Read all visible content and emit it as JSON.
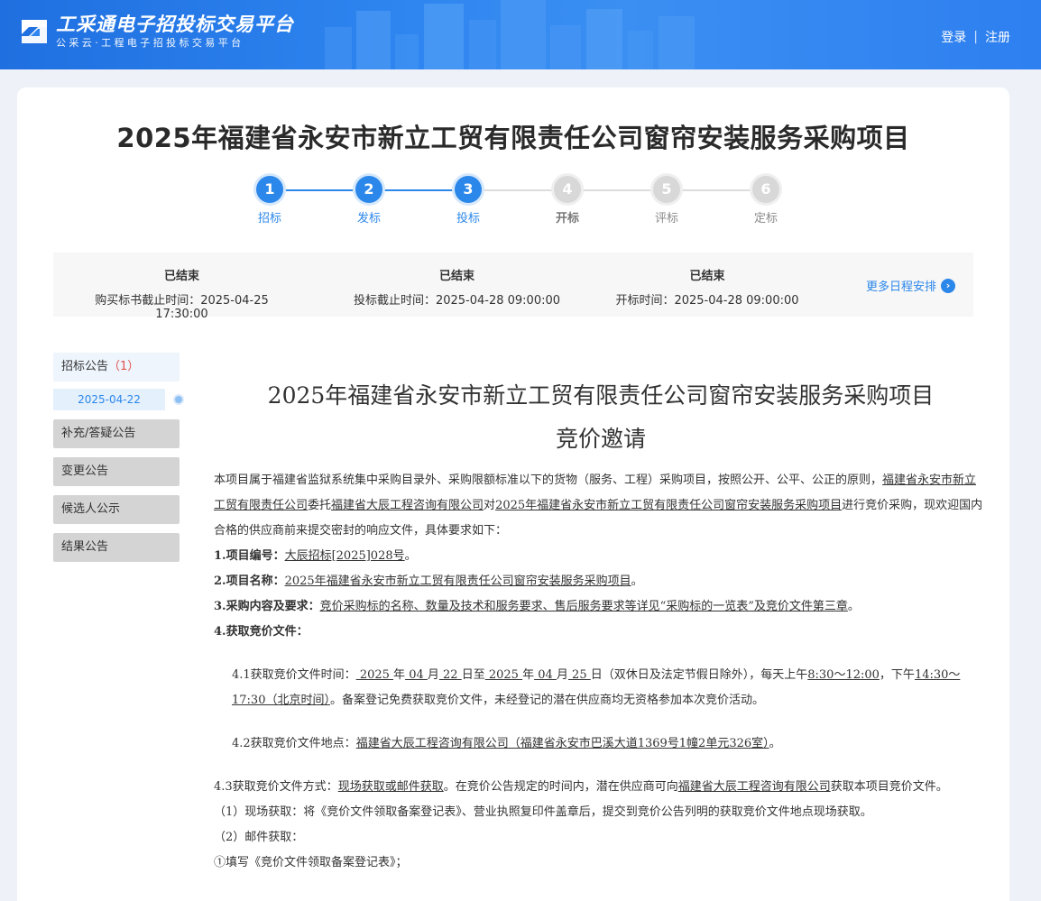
{
  "header": {
    "logo_title": "工采通电子招投标交易平台",
    "logo_subtitle": "公采云·工程电子招投标交易平台",
    "login": "登录",
    "divider": "|",
    "register": "注册"
  },
  "project": {
    "title": "2025年福建省永安市新立工贸有限责任公司窗帘安装服务采购项目"
  },
  "steps": [
    {
      "num": "1",
      "label": "招标",
      "state": "done"
    },
    {
      "num": "2",
      "label": "发标",
      "state": "done"
    },
    {
      "num": "3",
      "label": "投标",
      "state": "done"
    },
    {
      "num": "4",
      "label": "开标",
      "state": "todo"
    },
    {
      "num": "5",
      "label": "评标",
      "state": "todo"
    },
    {
      "num": "6",
      "label": "定标",
      "state": "todo"
    }
  ],
  "schedule": {
    "items": [
      {
        "status": "已结束",
        "text": "购买标书截止时间：2025-04-25 17:30:00"
      },
      {
        "status": "已结束",
        "text": "投标截止时间：2025-04-28 09:00:00"
      },
      {
        "status": "已结束",
        "text": "开标时间：2025-04-28 09:00:00"
      }
    ],
    "more_label": "更多日程安排"
  },
  "sidebar": {
    "active_label": "招标公告",
    "active_count": "（1）",
    "active_date": "2025-04-22",
    "items": [
      "补充/答疑公告",
      "变更公告",
      "候选人公示",
      "结果公告"
    ]
  },
  "article": {
    "title_line1": "2025年福建省永安市新立工贸有限责任公司窗帘安装服务采购项目",
    "title_line2": "竞价邀请",
    "intro_a": "本项目属于福建省监狱系统集中采购目录外、采购限额标准以下的货物（服务、工程）采购项目，按照公开、公平、公正的原则，",
    "intro_u1": "福建省永安市新立工贸有限责任公司",
    "intro_b": "委托",
    "intro_u2": "福建省大辰工程咨询有限公司",
    "intro_c": "对",
    "intro_u3": "2025年福建省永安市新立工贸有限责任公司窗帘安装服务采购项目",
    "intro_d": "进行竞价采购，现欢迎国内合格的供应商前来提交密封的响应文件，具体要求如下：",
    "item1_label": "1.项目编号：",
    "item1_value": "大辰招标[2025]028号",
    "item1_end": "。",
    "item2_label": "2.项目名称：",
    "item2_value": "2025年福建省永安市新立工贸有限责任公司窗帘安装服务采购项目",
    "item2_end": "。",
    "item3_label": "3.采购内容及要求：",
    "item3_value": "竞价采购标的名称、数量及技术和服务要求、售后服务要求等详见“采购标的一览表”及竞价文件第三章",
    "item3_end": "。",
    "item4_label": "4.获取竞价文件：",
    "s41_a": "4.1获取竞价文件时间：",
    "s41_u1": " 2025 ",
    "s41_t1": "年",
    "s41_u2": " 04 ",
    "s41_t2": "月",
    "s41_u3": " 22 ",
    "s41_t3": "日至",
    "s41_u4": " 2025 ",
    "s41_t4": "年",
    "s41_u5": " 04 ",
    "s41_t5": "月",
    "s41_u6": " 25 ",
    "s41_t6": "日（双休日及法定节假日除外），每天上午",
    "s41_u7": "8:30～12:00",
    "s41_t7": "，下午",
    "s41_u8": "14:30～17:30（北京时间）",
    "s41_t8": "。备案登记免费获取竞价文件，未经登记的潜在供应商均无资格参加本次竞价活动。",
    "s42_a": "4.2获取竞价文件地点：",
    "s42_u": "福建省大辰工程咨询有限公司（福建省永安市巴溪大道1369号1幢2单元326室）",
    "s42_end": "。",
    "s43_a": "4.3获取竞价文件方式：",
    "s43_u1": "现场获取或邮件获取",
    "s43_b": "。在竞价公告规定的时间内，潜在供应商可向",
    "s43_u2": "福建省大辰工程咨询有限公司",
    "s43_c": "获取本项目竞价文件。",
    "p1": "（1）现场获取：将《竞价文件领取备案登记表》、营业执照复印件盖章后，提交到竞价公告列明的获取竞价文件地点现场获取。",
    "p2": "（2）邮件获取：",
    "p3": "①填写《竞价文件领取备案登记表》；"
  }
}
